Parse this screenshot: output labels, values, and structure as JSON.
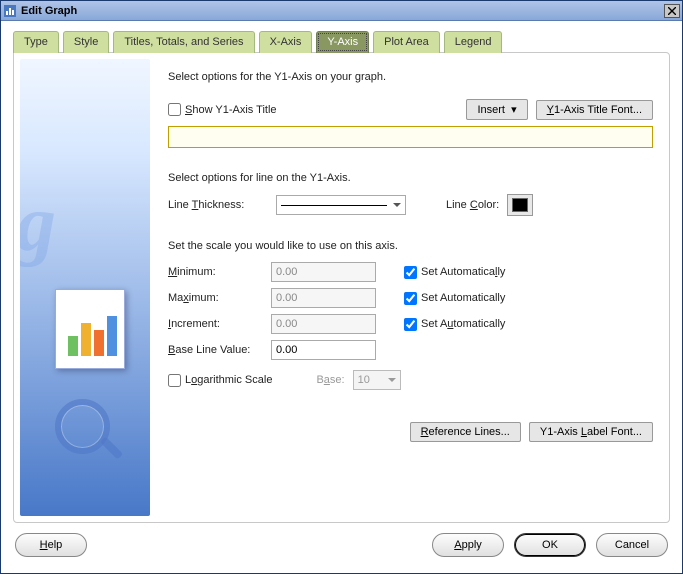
{
  "window": {
    "title": "Edit Graph"
  },
  "tabs": {
    "type": "Type",
    "style": "Style",
    "titles": "Titles, Totals, and Series",
    "xaxis": "X-Axis",
    "yaxis": "Y-Axis",
    "plotarea": "Plot Area",
    "legend": "Legend"
  },
  "yaxis": {
    "intro": "Select options for the Y1-Axis on your graph.",
    "show_title_label": "Show Y1-Axis Title",
    "show_title_checked": false,
    "insert_btn": "Insert",
    "title_font_btn": "Y1-Axis Title Font...",
    "title_value": "",
    "line_intro": "Select options for line on the Y1-Axis.",
    "line_thickness_label": "Line Thickness:",
    "line_color_label": "Line Color:",
    "scale_intro": "Set the scale you would like to use on this axis.",
    "minimum_label": "Minimum:",
    "minimum_value": "0.00",
    "maximum_label": "Maximum:",
    "maximum_value": "0.00",
    "increment_label": "Increment:",
    "increment_value": "0.00",
    "baseline_label": "Base Line Value:",
    "baseline_value": "0.00",
    "set_auto_label": "Set Automatically",
    "min_auto": true,
    "max_auto": true,
    "inc_auto": true,
    "log_label": "Logarithmic Scale",
    "log_checked": false,
    "base_label": "Base:",
    "base_value": "10",
    "reference_btn": "Reference Lines...",
    "label_font_btn": "Y1-Axis Label Font..."
  },
  "buttons": {
    "help": "Help",
    "apply": "Apply",
    "ok": "OK",
    "cancel": "Cancel"
  }
}
